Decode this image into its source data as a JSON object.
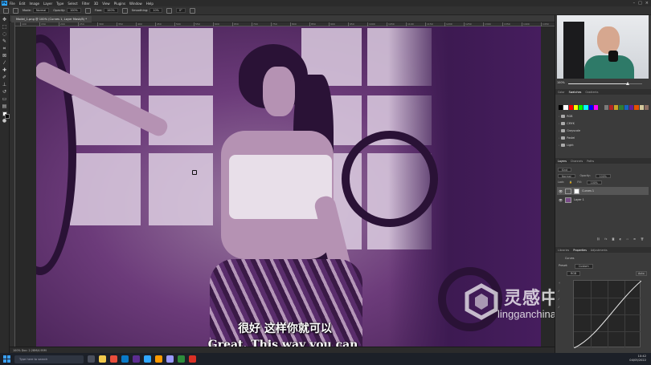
{
  "app": {
    "menus": [
      "File",
      "Edit",
      "Image",
      "Layer",
      "Type",
      "Select",
      "Filter",
      "3D",
      "View",
      "Plugins",
      "Window",
      "Help"
    ],
    "logo": "Ps"
  },
  "options_bar": {
    "mode_label": "Mode:",
    "mode_value": "Normal",
    "opacity_label": "Opacity:",
    "opacity_value": "100%",
    "flow_label": "Flow:",
    "flow_value": "100%",
    "smoothing_label": "Smoothing:",
    "smoothing_value": "10%",
    "angle_value": "0°"
  },
  "document": {
    "tab_title": "Model_1.png @ 100% (Curves 1, Layer Mask/8) *",
    "status": "100%   Doc: 2.28M/4.95M",
    "ruler_ticks": [
      "100",
      "150",
      "200",
      "250",
      "300",
      "350",
      "400",
      "450",
      "500",
      "550",
      "600",
      "650",
      "700",
      "750",
      "800",
      "850",
      "900",
      "950",
      "1000",
      "1050",
      "1100",
      "1150",
      "1200",
      "1250",
      "1300",
      "1350",
      "1400",
      "1450"
    ]
  },
  "subtitles": {
    "chinese": "很好 这样你就可以",
    "english": "Great. This way you can,"
  },
  "watermark": {
    "brand": "灵感中国",
    "url": "lingganchina.com"
  },
  "panels": {
    "navigator": {
      "zoom": "100%",
      "zoom_fraction": 0.8
    },
    "swatch_tabs": [
      "Color",
      "Swatches",
      "Gradients"
    ],
    "swatch_colors": [
      "#000000",
      "#ffffff",
      "#ff0000",
      "#ffff00",
      "#00ff00",
      "#00ffff",
      "#0000ff",
      "#ff00ff",
      "#3a3a3a",
      "#7a7a7a",
      "#b32424",
      "#c9a227",
      "#2e7d32",
      "#1565c0",
      "#6a1b9a",
      "#e65100",
      "#d4c89c",
      "#8d6e63"
    ],
    "swatch_folders": [
      "RGB",
      "CMYK",
      "Grayscale",
      "Pastel",
      "Light"
    ],
    "layers_tabs": [
      "Layers",
      "Channels",
      "Paths"
    ],
    "layers_kind": "Kind",
    "blend_mode": "Normal",
    "opacity_label": "Opacity:",
    "opacity_value": "100%",
    "lock_label": "Lock:",
    "fill_label": "Fill:",
    "fill_value": "100%",
    "layers": [
      {
        "name": "Curves 1",
        "selected": true
      },
      {
        "name": "Layer 1",
        "selected": false
      }
    ],
    "props_tabs": [
      "Libraries",
      "Properties",
      "Adjustments"
    ],
    "props_title": "Curves",
    "preset_label": "Preset:",
    "preset_value": "Custom",
    "channel_value": "RGB",
    "auto_label": "Auto"
  },
  "taskbar": {
    "search_placeholder": "Type here to search",
    "time": "10:42",
    "date": "04/05/2022"
  }
}
